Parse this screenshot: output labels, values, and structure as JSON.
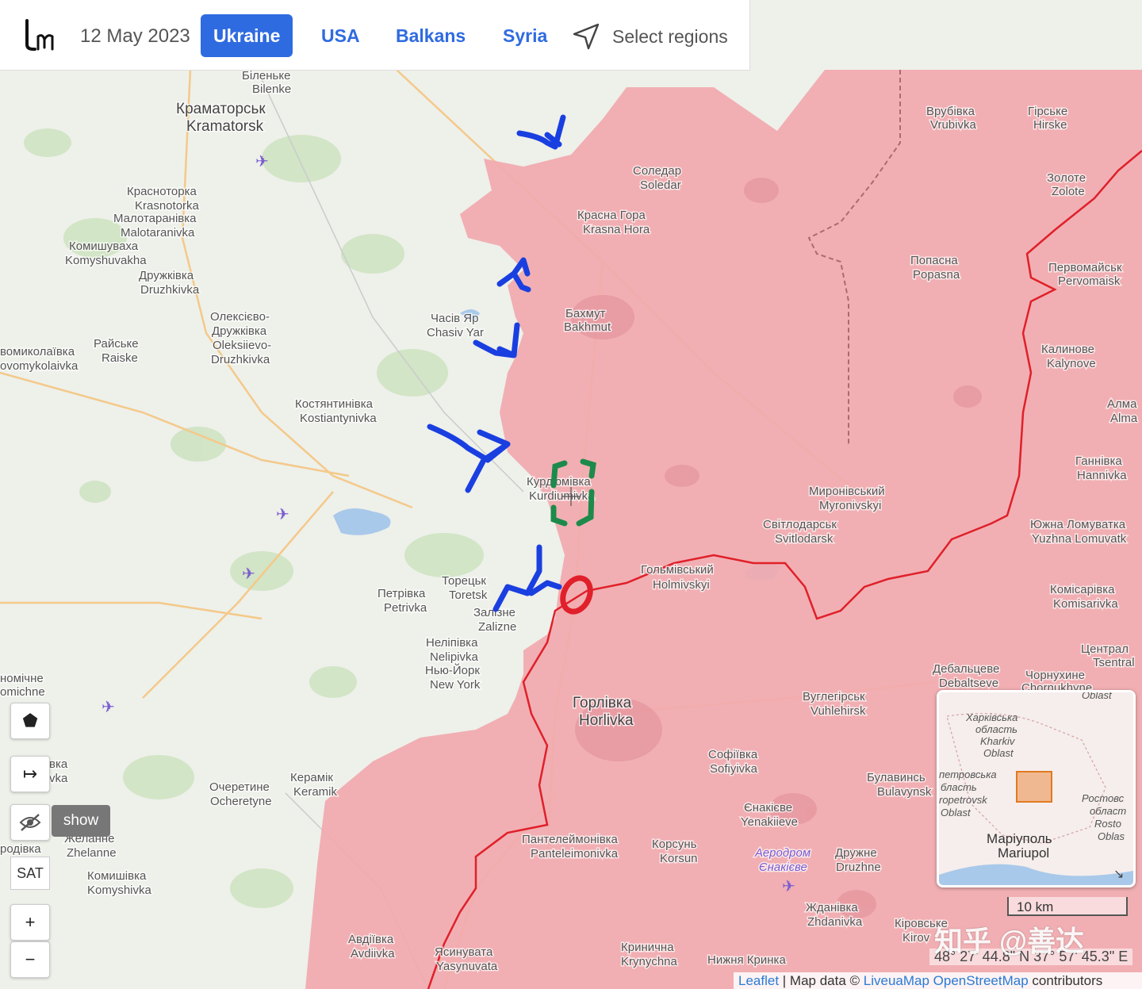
{
  "header": {
    "date": "12 May 2023",
    "tabs": [
      {
        "label": "Ukraine",
        "active": true
      },
      {
        "label": "USA",
        "active": false
      },
      {
        "label": "Balkans",
        "active": false
      },
      {
        "label": "Syria",
        "active": false
      }
    ],
    "select_regions": "Select regions"
  },
  "colors": {
    "occupied": "#f1a9ae",
    "border_red": "#e0202a",
    "arrow_blue": "#1a3fe0",
    "bracket_green": "#1d8a4b",
    "accent": "#2f6be0"
  },
  "map": {
    "labels": {
      "bilenke": [
        "Біленьке",
        "Bilenke"
      ],
      "kramatorsk": [
        "Краматорськ",
        "Kramatorsk"
      ],
      "krasnotorka": [
        "Краснотор­ка",
        "Krasnotorka"
      ],
      "malotaranivka": [
        "Малотаранівка",
        "Malotaranivka"
      ],
      "komyshuvakha": [
        "Комишуваха",
        "Komyshuvakha"
      ],
      "druzhkivka": [
        "Дружківка",
        "Druzhkivka"
      ],
      "oleksiievo": [
        "Олексієво-",
        "Дружківка",
        "Oleksiievo-",
        "Druzhkivka"
      ],
      "raiske": [
        "Райське",
        "Raiske"
      ],
      "novomykolaivka": [
        "вомиколаївка",
        "ovomykolaivka"
      ],
      "chasiv_yar": [
        "Часів Яр",
        "Chasiv Yar"
      ],
      "kostiantynivka": [
        "Костянтинівка",
        "Kostiantynivka"
      ],
      "soledar": [
        "Соледар",
        "Soledar"
      ],
      "krasna_hora": [
        "Красна Гора",
        "Krasna Hora"
      ],
      "bakhmut": [
        "Бахмут",
        "Bakhmut"
      ],
      "vrubivka": [
        "Врубівка",
        "Vrubivka"
      ],
      "hirske": [
        "Гірське",
        "Hirske"
      ],
      "zolote": [
        "Золоте",
        "Zolote"
      ],
      "popasna": [
        "Попасна",
        "Popasna"
      ],
      "pervomaisk": [
        "Первомайськ",
        "Pervomaisk"
      ],
      "kalynove": [
        "Калинове",
        "Kalynove"
      ],
      "almaz": [
        "Алма",
        "Alma"
      ],
      "hannivka": [
        "Ганнівка",
        "Hannivka"
      ],
      "kurdiumivka": [
        "Курдюмівка",
        "Kurdiumivka"
      ],
      "myronivskyi": [
        "Миронівський",
        "Myronivskyi"
      ],
      "svitlodarsk": [
        "Світлодарськ",
        "Svitlodarsk"
      ],
      "yuzhna": [
        "Южна Ломуватка",
        "Yuzhna Lomuvatk"
      ],
      "holmivskyi": [
        "Гольмівський",
        "Holmivskyi"
      ],
      "komisarivka": [
        "Комісарівка",
        "Komisarivka"
      ],
      "toretsk": [
        "Торецьк",
        "Toretsk"
      ],
      "petrivka": [
        "Петрівка",
        "Petrivka"
      ],
      "zalizne": [
        "Залізне",
        "Zalizne"
      ],
      "nelipivka": [
        "Неліпівка",
        "Nelipivka"
      ],
      "new_york": [
        "Нью-Йорк",
        "New York"
      ],
      "debaltseve": [
        "Дебальцеве",
        "Debaltseve"
      ],
      "chornukhyne": [
        "Чорнухине",
        "Chornukhyne"
      ],
      "tsentral": [
        "Централ",
        "Tsentral"
      ],
      "horlivka": [
        "Горлівка",
        "Horlivka"
      ],
      "vuhlehirsk": [
        "Вуглегірськ",
        "Vuhlehirsk"
      ],
      "sofiivka": [
        "Софіївка",
        "Sofiyivka"
      ],
      "bulavynske": [
        "Булавинсь",
        "Bulavynsk"
      ],
      "yenakiieve": [
        "Єнакієве",
        "Yenakiieve"
      ],
      "ocheretyne": [
        "Очеретине",
        "Ocheretyne"
      ],
      "keramik": [
        "Керамік",
        "Keramik"
      ],
      "zhelanne": [
        "Желанне",
        "Zhelanne"
      ],
      "komyshivka": [
        "Комишівка",
        "Komyshivka"
      ],
      "panteleimonivka": [
        "Пантелеймонівка",
        "Panteleimonivka"
      ],
      "korsun": [
        "Корсунь",
        "Korsun"
      ],
      "airport": [
        "Аеродром",
        "Єнакієве"
      ],
      "druzhne": [
        "Дружне",
        "Druzhne"
      ],
      "zhdanivka": [
        "Жданівка",
        "Zhdanivka"
      ],
      "kirovske": [
        "Кіровське",
        "Kirov"
      ],
      "avdiivka": [
        "Авдіївка",
        "Avdiivka"
      ],
      "yasynuvata": [
        "Ясинувата",
        "Yasynuvata"
      ],
      "krynychna": [
        "Кринична",
        "Krynychna"
      ],
      "nyzhnia": [
        "Нижня Кринка"
      ],
      "nomichne": [
        "номічне",
        "omichne"
      ],
      "vka": [
        "вка",
        "vka"
      ],
      "rodivka": [
        "родівка"
      ]
    }
  },
  "controls": {
    "polygon_icon": "pentagon-icon",
    "measure_icon": "arrow-right-bar-icon",
    "hide_icon": "eye-slash-icon",
    "show_label": "show",
    "sat_label": "SAT",
    "zoom_in": "+",
    "zoom_out": "−"
  },
  "minimap": {
    "labels": [
      "Харківська",
      "область",
      "Kharkiv",
      "Oblast",
      "петровська",
      "бласть",
      "ropetrovsk",
      "Oblast",
      "Ростовс",
      "област",
      "Rosto",
      "Oblas",
      "Маріуполь",
      "Mariupol",
      "Oblast"
    ]
  },
  "scale": "10 km",
  "coords": "48° 27' 44.8\" N 37° 57' 45.3\" E",
  "attribution": {
    "leaflet": "Leaflet",
    "sep": " | Map data © ",
    "liveuamap": "LiveuaMap",
    "osm": "OpenStreetMap",
    "contrib": " contributors"
  },
  "watermark": "知乎 @善达"
}
